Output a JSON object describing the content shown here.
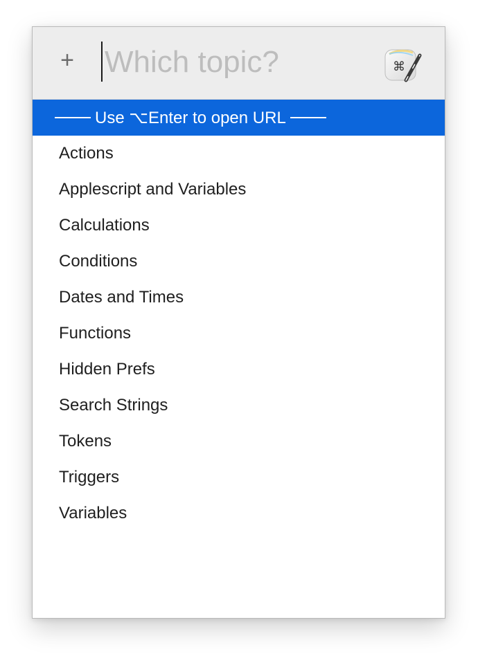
{
  "search": {
    "placeholder": "Which topic?",
    "value": ""
  },
  "header": {
    "add_label": "+",
    "app_icon": "keyboard-maestro-icon"
  },
  "highlight": {
    "label": "Use ⌥Enter to open URL"
  },
  "topics": [
    "Actions",
    "Applescript and Variables",
    "Calculations",
    "Conditions",
    "Dates and Times",
    "Functions",
    "Hidden Prefs",
    "Search Strings",
    "Tokens",
    "Triggers",
    "Variables"
  ],
  "colors": {
    "selection": "#0c66dc",
    "header_bg": "#ededed"
  }
}
